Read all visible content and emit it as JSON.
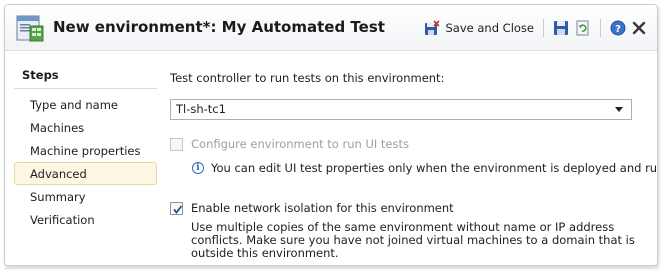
{
  "window": {
    "title": "New environment*: My Automated Test"
  },
  "toolbar": {
    "save_close_label": "Save and Close"
  },
  "steps": {
    "header": "Steps",
    "items": [
      {
        "label": "Type and name"
      },
      {
        "label": "Machines"
      },
      {
        "label": "Machine properties"
      },
      {
        "label": "Advanced",
        "active": true
      },
      {
        "label": "Summary"
      },
      {
        "label": "Verification"
      }
    ]
  },
  "advanced": {
    "controller_label": "Test controller to run tests on this environment:",
    "controller_value": "Tl-sh-tc1",
    "ui_tests_label": "Configure environment to run UI tests",
    "ui_tests_checked": false,
    "ui_tests_enabled": false,
    "info_text": "You can edit UI test properties only when the environment is deployed and running.",
    "isolation_label": "Enable network isolation for this environment",
    "isolation_checked": true,
    "isolation_description": "Use multiple copies of the same environment without name or IP address conflicts. Make sure you have not joined virtual machines to a domain that is outside this environment."
  },
  "colors": {
    "accent_blue": "#3569b5",
    "active_step_bg": "#fcf7e3",
    "disabled_text": "#9aa0a6"
  },
  "icons": {
    "title": "environment-icon",
    "save_close": "save-close-icon",
    "save": "floppy-disk-icon",
    "refresh": "refresh-icon",
    "help": "help-icon",
    "close": "close-icon",
    "info": "info-icon",
    "check": "checkmark-icon"
  }
}
